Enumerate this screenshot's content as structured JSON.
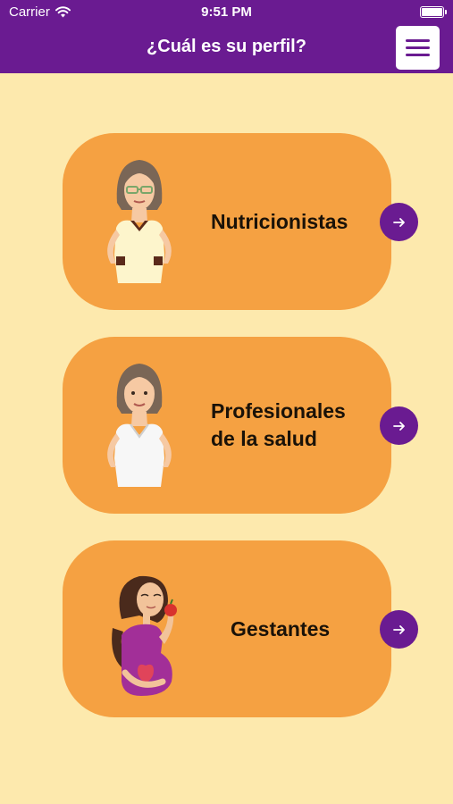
{
  "status_bar": {
    "carrier": "Carrier",
    "time": "9:51 PM"
  },
  "header": {
    "title": "¿Cuál es su perfil?",
    "menu_icon": "hamburger-icon"
  },
  "profiles": [
    {
      "label": "Nutricionistas",
      "icon": "nutritionist-woman-icon"
    },
    {
      "label_line1": "Profesionales",
      "label_line2": "de la salud",
      "icon": "health-professional-woman-icon"
    },
    {
      "label": "Gestantes",
      "icon": "pregnant-woman-icon"
    }
  ],
  "colors": {
    "header": "#6a1b91",
    "background": "#fde9ad",
    "card": "#f5a142",
    "arrow": "#6a1b91"
  }
}
